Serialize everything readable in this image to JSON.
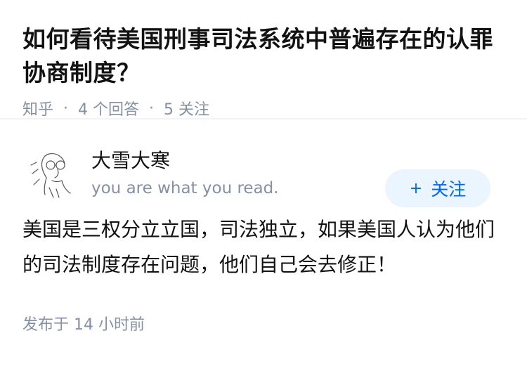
{
  "question": {
    "title": "如何看待美国刑事司法系统中普遍存在的认罪协商制度？",
    "source": "知乎",
    "separator": "·",
    "answers_count": "4 个回答",
    "followers_count": "5 关注"
  },
  "answer": {
    "author": {
      "name": "大雪大寒",
      "bio": "you are what you read."
    },
    "follow_button": {
      "plus": "+",
      "label": "关注"
    },
    "content": "美国是三权分立立国，司法独立，如果美国人认为他们的司法制度存在问题，他们自己会去修正！",
    "published": "发布于  14 小时前"
  },
  "colors": {
    "meta_gray": "#8590a6",
    "follow_bg": "#ebf5ff",
    "follow_text": "#0066ff"
  }
}
